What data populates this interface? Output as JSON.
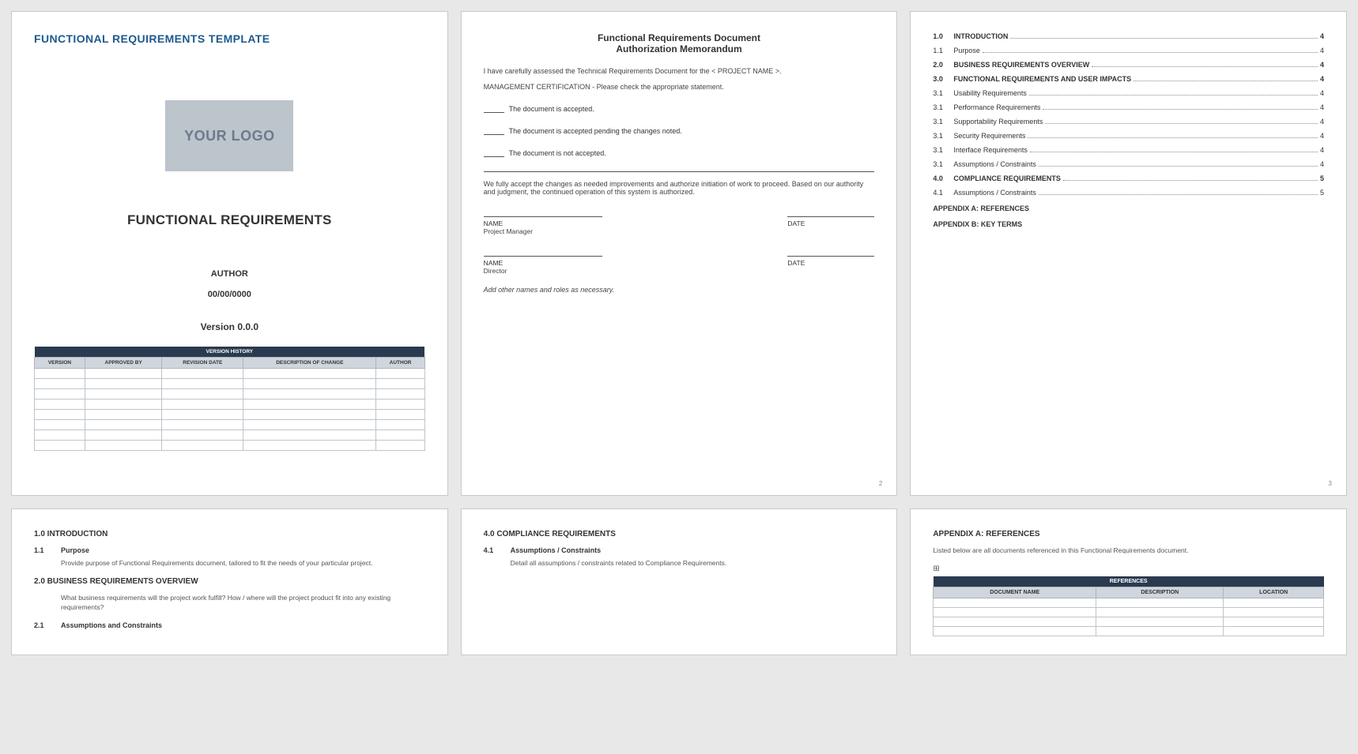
{
  "page1": {
    "template_title": "FUNCTIONAL REQUIREMENTS TEMPLATE",
    "logo_placeholder": "YOUR LOGO",
    "doc_title": "FUNCTIONAL REQUIREMENTS",
    "author_label": "AUTHOR",
    "date_value": "00/00/0000",
    "version_label": "Version 0.0.0",
    "version_history": {
      "caption": "VERSION HISTORY",
      "columns": [
        "VERSION",
        "APPROVED BY",
        "REVISION DATE",
        "DESCRIPTION OF CHANGE",
        "AUTHOR"
      ],
      "empty_rows": 8
    }
  },
  "page2": {
    "title_line1": "Functional Requirements Document",
    "title_line2": "Authorization Memorandum",
    "intro": "I have carefully assessed the Technical Requirements Document for the < PROJECT NAME >.",
    "certification": "MANAGEMENT CERTIFICATION - Please check the appropriate statement.",
    "opt1": "The document is accepted.",
    "opt2": "The document is accepted pending the changes noted.",
    "opt3": "The document is not accepted.",
    "acceptance": "We fully accept the changes as needed improvements and authorize initiation of work to proceed. Based on our authority and judgment, the continued operation of this system is authorized.",
    "name_label": "NAME",
    "date_label": "DATE",
    "role1": "Project Manager",
    "role2": "Director",
    "addnote": "Add other names and roles as necessary.",
    "pageno": "2"
  },
  "page3": {
    "toc": [
      {
        "num": "1.0",
        "title": "INTRODUCTION",
        "page": "4",
        "bold": true
      },
      {
        "num": "1.1",
        "title": "Purpose",
        "page": "4",
        "bold": false
      },
      {
        "num": "2.0",
        "title": "BUSINESS REQUIREMENTS OVERVIEW",
        "page": "4",
        "bold": true
      },
      {
        "num": "3.0",
        "title": "FUNCTIONAL REQUIREMENTS AND USER IMPACTS",
        "page": "4",
        "bold": true
      },
      {
        "num": "3.1",
        "title": "Usability Requirements",
        "page": "4",
        "bold": false
      },
      {
        "num": "3.1",
        "title": "Performance Requirements",
        "page": "4",
        "bold": false
      },
      {
        "num": "3.1",
        "title": "Supportability Requirements",
        "page": "4",
        "bold": false
      },
      {
        "num": "3.1",
        "title": "Security Requirements",
        "page": "4",
        "bold": false
      },
      {
        "num": "3.1",
        "title": "Interface Requirements",
        "page": "4",
        "bold": false
      },
      {
        "num": "3.1",
        "title": "Assumptions / Constraints",
        "page": "4",
        "bold": false
      },
      {
        "num": "4.0",
        "title": "COMPLIANCE REQUIREMENTS",
        "page": "5",
        "bold": true
      },
      {
        "num": "4.1",
        "title": "Assumptions / Constraints",
        "page": "5",
        "bold": false
      }
    ],
    "appendix_a": "APPENDIX A: REFERENCES",
    "appendix_b": "APPENDIX B: KEY TERMS",
    "pageno": "3"
  },
  "page4": {
    "s1": "1.0  INTRODUCTION",
    "s1_1_num": "1.1",
    "s1_1_title": "Purpose",
    "s1_1_body": "Provide purpose of Functional Requirements document, tailored to fit the needs of your particular project.",
    "s2": "2.0  BUSINESS REQUIREMENTS OVERVIEW",
    "s2_body": "What business requirements will the project work fulfill?  How / where will the project product fit into any existing requirements?",
    "s2_1_num": "2.1",
    "s2_1_title": "Assumptions and Constraints"
  },
  "page5": {
    "s4": "4.0  COMPLIANCE REQUIREMENTS",
    "s4_1_num": "4.1",
    "s4_1_title": "Assumptions / Constraints",
    "s4_1_body": "Detail all assumptions / constraints related to Compliance Requirements."
  },
  "page6": {
    "title": "APPENDIX A: REFERENCES",
    "desc": "Listed below are all documents referenced in this Functional Requirements document.",
    "references": {
      "caption": "REFERENCES",
      "columns": [
        "DOCUMENT NAME",
        "DESCRIPTION",
        "LOCATION"
      ],
      "empty_rows": 4
    }
  }
}
